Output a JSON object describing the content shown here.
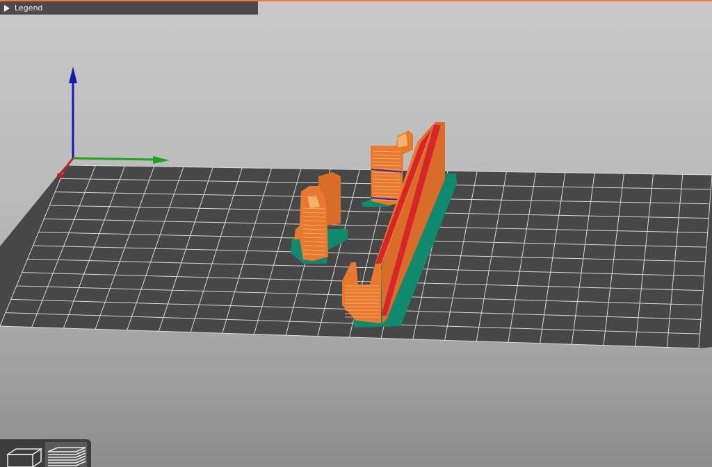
{
  "legend": {
    "label": "Legend",
    "icon": "triangle-right-icon"
  },
  "axes": {
    "x_color": "#1fa11f",
    "y_color": "#c41e1e",
    "z_color": "#1717b8"
  },
  "bed": {
    "color": "#474747",
    "grid_color": "#d8d8d8"
  },
  "colors": {
    "model_orange": "#e8792f",
    "model_red": "#d6262a",
    "skirt_teal": "#0f8a6f",
    "seam_blue": "#2a2aa0",
    "accent_top_line": "#f07b2f"
  },
  "toolbar": {
    "buttons": [
      {
        "name": "3d-view",
        "icon": "cube-icon"
      },
      {
        "name": "preview",
        "icon": "layers-icon"
      }
    ]
  }
}
